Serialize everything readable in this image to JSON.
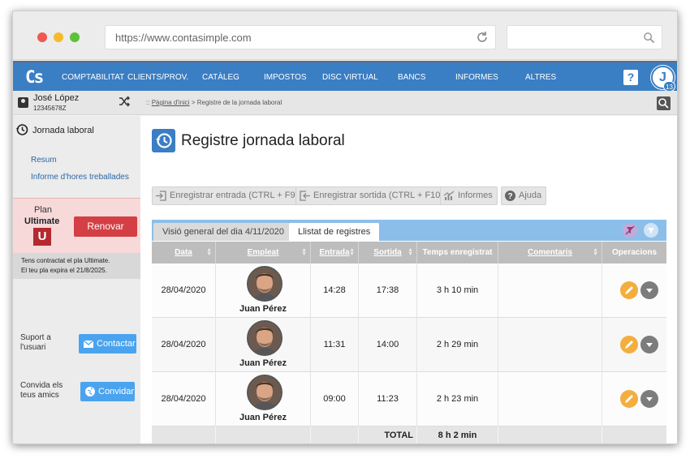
{
  "browser": {
    "url": "https://www.contasimple.com"
  },
  "navbar": {
    "logo": "Cs",
    "items": [
      "COMPTABILITAT",
      "CLIENTS/PROV.",
      "CATÀLEG",
      "IMPOSTOS",
      "DISC VIRTUAL",
      "BANCS",
      "INFORMES",
      "ALTRES"
    ],
    "help_label": "?",
    "user_initial": "J",
    "notification_count": "13",
    "accent": "#3a7ec4"
  },
  "user": {
    "name": "José López",
    "id": "12345678Z"
  },
  "breadcrumb": {
    "prefix": "::",
    "home": "Pàgina d'inici",
    "separator": ">",
    "current": "Registre de la jornada laboral"
  },
  "sidebar": {
    "section_title": "Jornada laboral",
    "links": [
      "Resum",
      "Informe d'hores treballades"
    ],
    "plan": {
      "label": "Plan",
      "name": "Ultimate",
      "badge": "U",
      "renew_label": "Renovar",
      "note_line1": "Tens contractat el pla Ultimate.",
      "note_line2": "El teu pla expira el 21/8/2025."
    },
    "support": {
      "label_line1": "Suport a",
      "label_line2": "l'usuari",
      "button": "Contactar"
    },
    "invite": {
      "label_line1": "Convida els",
      "label_line2": "teus amics",
      "button": "Convidar"
    }
  },
  "main": {
    "title": "Registre jornada laboral",
    "toolbar": [
      {
        "label": "Enregistrar entrada (CTRL + F9)",
        "icon": "sign-in-icon"
      },
      {
        "label": "Enregistrar sortida (CTRL + F10)",
        "icon": "sign-out-icon"
      },
      {
        "label": "Informes",
        "icon": "chart-icon"
      },
      {
        "label": "Ajuda",
        "icon": "help-icon"
      }
    ],
    "tabs": [
      {
        "label": "Visió general del dia 4/11/2020",
        "active": false
      },
      {
        "label": "Llistat de registres",
        "active": true
      }
    ],
    "table": {
      "columns": [
        "Data",
        "Empleat",
        "Entrada",
        "Sortida",
        "Temps enregistrat",
        "Comentaris",
        "Operacions"
      ],
      "rows": [
        {
          "date": "28/04/2020",
          "employee": "Juan Pérez",
          "in": "14:28",
          "out": "17:38",
          "time": "3 h 10 min",
          "comments": ""
        },
        {
          "date": "28/04/2020",
          "employee": "Juan Pérez",
          "in": "11:31",
          "out": "14:00",
          "time": "2 h 29 min",
          "comments": ""
        },
        {
          "date": "28/04/2020",
          "employee": "Juan Pérez",
          "in": "09:00",
          "out": "11:23",
          "time": "2 h 23 min",
          "comments": ""
        }
      ],
      "total_label": "TOTAL",
      "total_value": "8 h 2 min"
    }
  }
}
